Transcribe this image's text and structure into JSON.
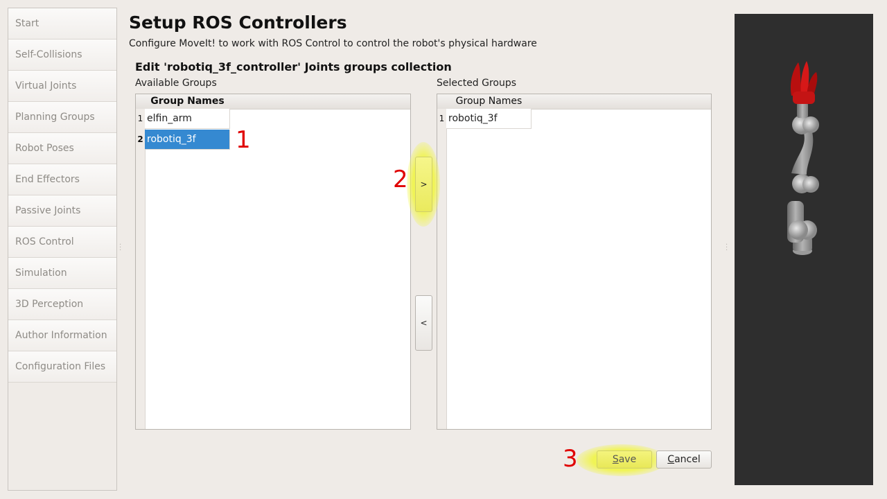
{
  "sidebar": {
    "items": [
      {
        "label": "Start"
      },
      {
        "label": "Self-Collisions"
      },
      {
        "label": "Virtual Joints"
      },
      {
        "label": "Planning Groups"
      },
      {
        "label": "Robot Poses"
      },
      {
        "label": "End Effectors"
      },
      {
        "label": "Passive Joints"
      },
      {
        "label": "ROS Control"
      },
      {
        "label": "Simulation"
      },
      {
        "label": "3D Perception"
      },
      {
        "label": "Author Information"
      },
      {
        "label": "Configuration Files"
      }
    ]
  },
  "header": {
    "title": "Setup ROS Controllers",
    "subtitle": "Configure MoveIt! to work with ROS Control to control the robot's physical hardware"
  },
  "editor": {
    "title": "Edit 'robotiq_3f_controller' Joints groups collection",
    "available": {
      "label": "Available Groups",
      "column": "Group Names",
      "rows": [
        {
          "num": "1",
          "name": "elfin_arm",
          "selected": false
        },
        {
          "num": "2",
          "name": "robotiq_3f",
          "selected": true
        }
      ]
    },
    "selected": {
      "label": "Selected Groups",
      "column": "Group Names",
      "rows": [
        {
          "num": "1",
          "name": "robotiq_3f"
        }
      ]
    },
    "add_arrow": ">",
    "remove_arrow": "<"
  },
  "buttons": {
    "save": "Save",
    "cancel": "Cancel"
  },
  "annotations": {
    "step1": "1",
    "step2": "2",
    "step3": "3"
  },
  "colors": {
    "selection": "#3589d1",
    "highlight": "#eeee66",
    "annotation": "#e00000",
    "viewport_bg": "#2e2e2e",
    "gripper": "#cc1111"
  }
}
